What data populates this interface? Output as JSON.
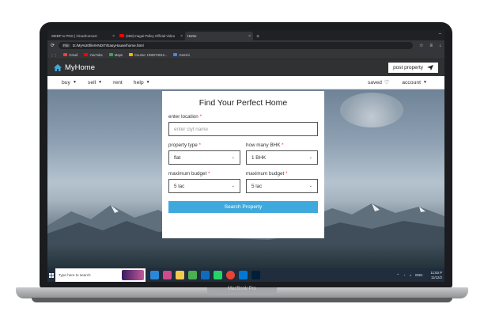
{
  "browser": {
    "tabs": [
      {
        "label": "WEBP to PNG | CloudConvert",
        "active": false
      },
      {
        "label": "(459) Inagai Pulley Official Video",
        "active": false
      },
      {
        "label": "Home",
        "active": true
      }
    ],
    "new_tab": "+",
    "url": "D:/My%20file/HNDIT/EasyHouse/home.html",
    "file_chip": "File",
    "bookmarks": [
      "Gmail",
      "YouTube",
      "Maps",
      "Course: HNDIT3012...",
      "Gemini"
    ]
  },
  "site": {
    "brand": "MyHome",
    "post_property": "post property",
    "menu_left": [
      "buy",
      "sell",
      "rent",
      "help"
    ],
    "menu_right": [
      "saved",
      "account"
    ]
  },
  "form": {
    "title": "Find Your Perfect Home",
    "location_label": "enter location",
    "location_placeholder": "enter ciyt name",
    "property_type_label": "property type",
    "property_type_value": "flat",
    "bhk_label": "how many BHK",
    "bhk_value": "1 BHK",
    "min_budget_label": "maximum budget",
    "min_budget_value": "5 lac",
    "max_budget_label": "maximum budget",
    "max_budget_value": "5 lac",
    "required_mark": "*",
    "search_button": "Search Property"
  },
  "taskbar": {
    "search_placeholder": "Type here to search",
    "lang": "ENG",
    "time": "11:53 P",
    "date": "11/12/2"
  },
  "device": {
    "label": "MacBook Pro"
  }
}
